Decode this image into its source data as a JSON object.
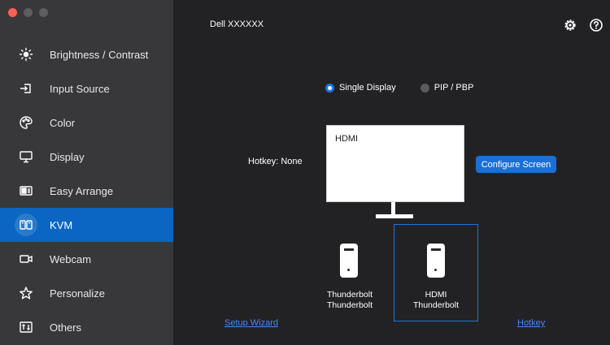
{
  "window": {
    "title": "Dell XXXXXX"
  },
  "sidebar": {
    "items": [
      {
        "label": "Brightness / Contrast",
        "icon": "sun-icon"
      },
      {
        "label": "Input Source",
        "icon": "input-source-icon"
      },
      {
        "label": "Color",
        "icon": "palette-icon"
      },
      {
        "label": "Display",
        "icon": "monitor-icon"
      },
      {
        "label": "Easy Arrange",
        "icon": "layout-icon"
      },
      {
        "label": "KVM",
        "icon": "kvm-icon",
        "active": true
      },
      {
        "label": "Webcam",
        "icon": "webcam-icon"
      },
      {
        "label": "Personalize",
        "icon": "star-icon"
      },
      {
        "label": "Others",
        "icon": "others-icon"
      }
    ]
  },
  "kvm": {
    "modes": [
      {
        "label": "Single Display",
        "selected": true
      },
      {
        "label": "PIP / PBP",
        "selected": false
      }
    ],
    "monitor_label": "HDMI",
    "hotkey_text": "Hotkey: None",
    "configure_button": "Configure Screen",
    "computers": [
      {
        "line1": "Thunderbolt",
        "line2": "Thunderbolt",
        "selected": false
      },
      {
        "line1": "HDMI",
        "line2": "Thunderbolt",
        "selected": true
      }
    ],
    "setup_wizard_link": "Setup Wizard",
    "hotkey_link": "Hotkey"
  },
  "colors": {
    "accent": "#0a66c2",
    "sidebar_bg": "#38383a",
    "main_bg": "#222224",
    "link": "#3d8bff"
  }
}
